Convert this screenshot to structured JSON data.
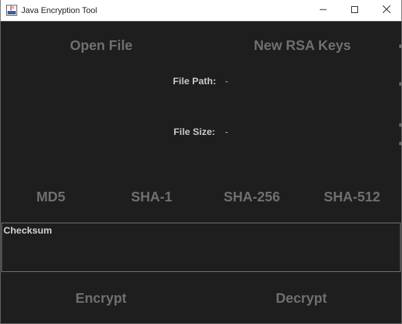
{
  "window": {
    "title": "Java Encryption Tool",
    "controls": {
      "minimize_icon": "minimize-icon",
      "maximize_icon": "maximize-icon",
      "close_icon": "close-icon"
    }
  },
  "actions": {
    "open_file": "Open File",
    "new_rsa_keys": "New RSA Keys",
    "encrypt": "Encrypt",
    "decrypt": "Decrypt"
  },
  "file_info": {
    "path_label": "File Path:",
    "path_value": "-",
    "size_label": "File Size:",
    "size_value": "-"
  },
  "hash_buttons": [
    "MD5",
    "SHA-1",
    "SHA-256",
    "SHA-512"
  ],
  "checksum": {
    "title": "Checksum",
    "value": ""
  },
  "colors": {
    "background": "#1e1e1e",
    "button_text": "#6f6f6f",
    "label_text": "#c9c9c9",
    "border": "#7a7a7a",
    "titlebar": "#ffffff"
  }
}
